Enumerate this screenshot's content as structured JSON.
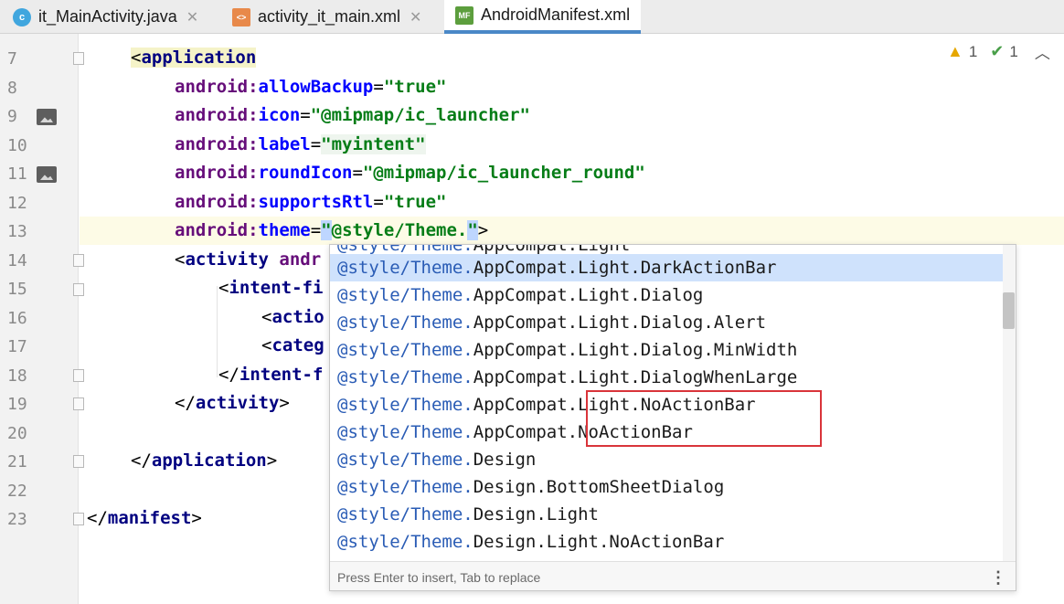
{
  "tabs": [
    {
      "label": "it_MainActivity.java",
      "icon": "java-class-icon",
      "active": false
    },
    {
      "label": "activity_it_main.xml",
      "icon": "xml-file-icon",
      "active": false
    },
    {
      "label": "AndroidManifest.xml",
      "icon": "manifest-file-icon",
      "active": true
    }
  ],
  "tab_icon_text": {
    "java": "c",
    "xml": "<>",
    "mf": "MF"
  },
  "close_glyph": "✕",
  "inspection": {
    "warnings": "1",
    "weak_warnings": "1"
  },
  "gutter": {
    "line_numbers": [
      "7",
      "8",
      "9",
      "10",
      "11",
      "12",
      "13",
      "14",
      "15",
      "16",
      "17",
      "18",
      "19",
      "20",
      "21",
      "22",
      "23"
    ]
  },
  "code": {
    "l7": {
      "open": "<",
      "tag": "application"
    },
    "l8": {
      "ns": "android:",
      "attr": "allowBackup",
      "eq": "=",
      "val": "\"true\""
    },
    "l9": {
      "ns": "android:",
      "attr": "icon",
      "eq": "=",
      "val": "\"@mipmap/ic_launcher\""
    },
    "l10": {
      "ns": "android:",
      "attr": "label",
      "eq": "=",
      "val": "\"myintent\""
    },
    "l11": {
      "ns": "android:",
      "attr": "roundIcon",
      "eq": "=",
      "val": "\"@mipmap/ic_launcher_round\""
    },
    "l12": {
      "ns": "android:",
      "attr": "supportsRtl",
      "eq": "=",
      "val": "\"true\""
    },
    "l13": {
      "ns": "android:",
      "attr": "theme",
      "eq": "=",
      "q1": "\"",
      "val": "@style/Theme.",
      "q2": "\"",
      "close": ">"
    },
    "l14": {
      "open": "<",
      "tag": "activity",
      "rest": " andr"
    },
    "l15": {
      "open": "<",
      "tag": "intent-fi"
    },
    "l16": {
      "open": "<",
      "tag": "actio"
    },
    "l17": {
      "open": "<",
      "tag": "categ"
    },
    "l18": {
      "open": "</",
      "tag": "intent-f"
    },
    "l19": {
      "open": "</",
      "tag": "activity",
      "close": ">"
    },
    "l21": {
      "open": "</",
      "tag": "application",
      "close": ">"
    },
    "l23": {
      "open": "</",
      "tag": "manifest",
      "close": ">"
    }
  },
  "completion": {
    "prefix": "@style/Theme.",
    "items": [
      "AppCompat.Light",
      "AppCompat.Light.DarkActionBar",
      "AppCompat.Light.Dialog",
      "AppCompat.Light.Dialog.Alert",
      "AppCompat.Light.Dialog.MinWidth",
      "AppCompat.Light.DialogWhenLarge",
      "AppCompat.Light.NoActionBar",
      "AppCompat.NoActionBar",
      "Design",
      "Design.BottomSheetDialog",
      "Design.Light",
      "Design.Light.NoActionBar"
    ],
    "selected_index": 1,
    "footer": "Press Enter to insert, Tab to replace",
    "more_glyph": "⋮"
  },
  "colors": {
    "accent": "#4a88c7",
    "selection": "#cfe2fc",
    "highlight_box": "#d9343a"
  }
}
